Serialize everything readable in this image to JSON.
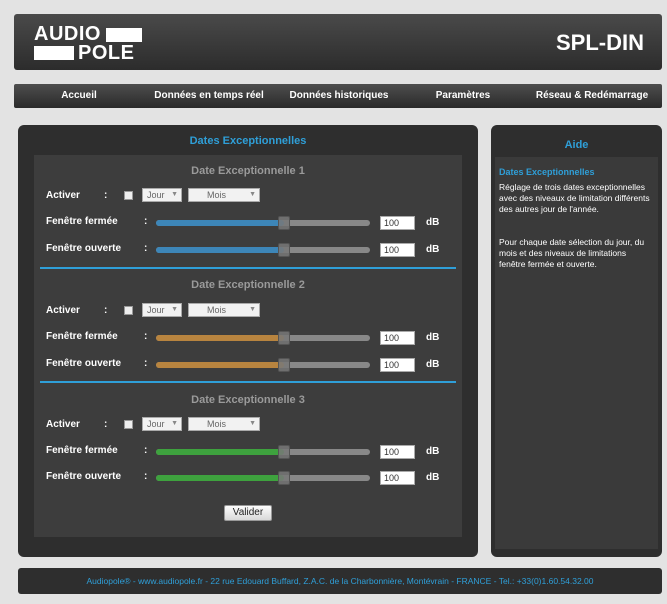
{
  "header": {
    "logo_top": "AUDIO",
    "logo_bottom": "POLE",
    "device_name": "SPL-DIN"
  },
  "nav": {
    "items": [
      {
        "label": "Accueil"
      },
      {
        "label": "Données en temps réel"
      },
      {
        "label": "Données historiques"
      },
      {
        "label": "Paramètres"
      },
      {
        "label": "Réseau & Redémarrage"
      }
    ]
  },
  "main": {
    "title": "Dates Exceptionnelles",
    "labels": {
      "activer": "Activer",
      "colon": ":",
      "fenetre_fermee": "Fenêtre fermée",
      "fenetre_ouverte": "Fenêtre ouverte",
      "unit": "dB",
      "jour": "Jour",
      "mois": "Mois"
    },
    "sections": [
      {
        "title": "Date Exceptionnelle 1",
        "color": "#3d86b8",
        "fermee_value": "100",
        "ouverte_value": "100",
        "fermee_level": 0.6,
        "ouverte_level": 0.6,
        "checked": false
      },
      {
        "title": "Date Exceptionnelle 2",
        "color": "#b8843f",
        "fermee_value": "100",
        "ouverte_value": "100",
        "fermee_level": 0.6,
        "ouverte_level": 0.6,
        "checked": false
      },
      {
        "title": "Date Exceptionnelle 3",
        "color": "#3ea23e",
        "fermee_value": "100",
        "ouverte_value": "100",
        "fermee_level": 0.6,
        "ouverte_level": 0.6,
        "checked": false
      }
    ],
    "valider_label": "Valider"
  },
  "aide": {
    "title": "Aide",
    "subtitle": "Dates Exceptionnelles",
    "paragraph1": "Réglage de trois dates exceptionnelles avec des niveaux de limitation différents des autres jour de l'année.",
    "paragraph2": "Pour chaque date sélection du jour, du mois et des niveaux de limitations fenêtre fermée et ouverte."
  },
  "footer": {
    "text": "Audiopole® - www.audiopole.fr - 22 rue Edouard Buffard, Z.A.C. de la Charbonnière, Montévrain - FRANCE - Tel.: +33(0)1.60.54.32.00"
  },
  "colors": {
    "accent": "#2f9fd8",
    "panel": "#2e2e2e",
    "background": "#e3e3e3"
  }
}
